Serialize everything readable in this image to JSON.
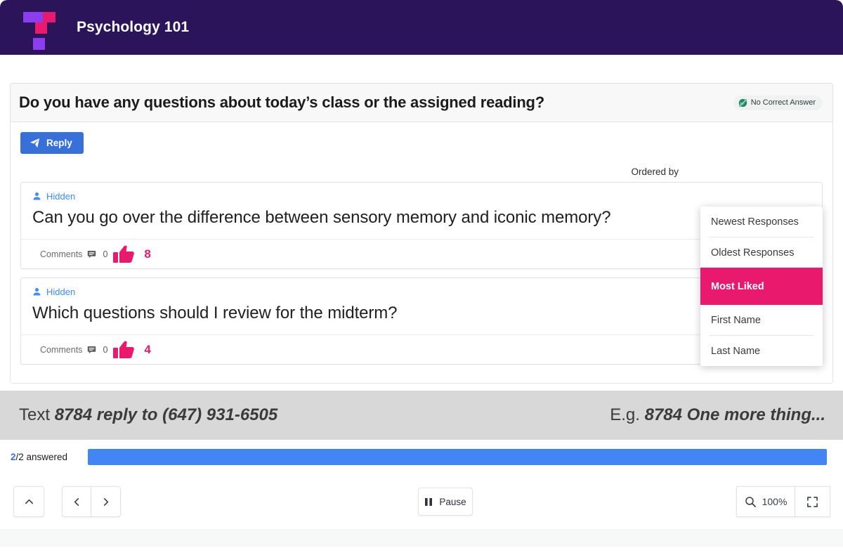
{
  "header": {
    "course_title": "Psychology 101",
    "logo_name": "top-hat-logo",
    "bg_color": "#2b1459",
    "logo_purple": "#8b3df0",
    "logo_pink": "#e91a6e"
  },
  "question": {
    "title": "Do you have any questions about today’s class or the assigned reading?",
    "badge_label": "No Correct Answer",
    "badge_icon": "no-correct-answer-icon",
    "reply_label": "Reply",
    "reply_icon": "paper-plane-icon",
    "ordered_by_label": "Ordered by"
  },
  "sort_menu": {
    "items": [
      {
        "label": "Newest Responses",
        "selected": false
      },
      {
        "label": "Oldest Responses",
        "selected": false
      },
      {
        "label": "Most Liked",
        "selected": true
      },
      {
        "label": "First Name",
        "selected": false
      },
      {
        "label": "Last Name",
        "selected": false
      }
    ],
    "highlight_color": "#e91a6e"
  },
  "responses": [
    {
      "author": "Hidden",
      "author_icon": "person-icon",
      "text": "Can you go over the difference between sensory memory and iconic memory?",
      "comments_label": "Comments",
      "comments_count": "0",
      "likes": "8"
    },
    {
      "author": "Hidden",
      "author_icon": "person-icon",
      "text": "Which questions should I review for the midterm?",
      "comments_label": "Comments",
      "comments_count": "0",
      "likes": "4"
    }
  ],
  "sms_bar": {
    "left_lead": "Text ",
    "left_emphasis": "8784 reply to (647) 931-6505",
    "right_lead": "E.g. ",
    "right_emphasis": "8784 One more thing..."
  },
  "progress": {
    "answered_num": "2",
    "answered_suffix": "/2 answered",
    "percent": 100,
    "fill_color": "#4285f4"
  },
  "toolbar": {
    "collapse_icon": "chevron-up-icon",
    "prev_icon": "chevron-left-icon",
    "next_icon": "chevron-right-icon",
    "pause_label": "Pause",
    "pause_icon": "pause-icon",
    "zoom_icon": "magnifier-icon",
    "zoom_level": "100%",
    "fullscreen_icon": "fullscreen-icon"
  }
}
